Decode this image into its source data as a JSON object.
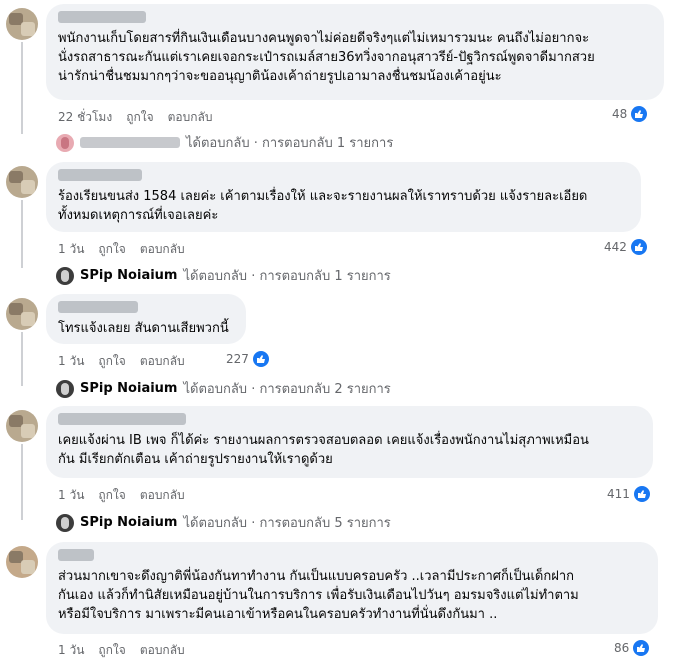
{
  "comments": [
    {
      "text_lines": [
        "พนักงานเก็บโดยสารที่กินเงินเดือนบางคนพูดจาไม่ค่อยดีจริงๆแต่ไม่เหมารวมนะ คนถึงไม่อยากจะ",
        "นั่งรถสาธารณะกันแต่เราเคยเจอกระเป๋ารถเมล์สาย36ทวิ่งจากอนุสาวรีย์-ปัฐวิกรณ์พูดจาดีมากสวย",
        "น่ารักน่าชื่นชมมากๆว่าจะขออนุญาติน้องเค้าถ่ายรูปเอามาลงชื่นชมน้องเค้าอยู่นะ"
      ],
      "time": "22 ชั่วโมง",
      "like_label": "ถูกใจ",
      "reply_label": "ตอบกลับ",
      "reactions": "48",
      "reply_summary": "ได้ตอบกลับ · การตอบกลับ 1 รายการ",
      "reply_user": ""
    },
    {
      "text_lines": [
        "ร้องเรียนขนส่ง 1584 เลยค่ะ เค้าตามเรื่องให้ และจะรายงานผลให้เราทราบด้วย แจ้งรายละเอียด",
        "ทั้งหมดเหตุการณ์ที่เจอเลยค่ะ"
      ],
      "time": "1 วัน",
      "like_label": "ถูกใจ",
      "reply_label": "ตอบกลับ",
      "reactions": "442",
      "reply_summary": "ได้ตอบกลับ · การตอบกลับ 1 รายการ",
      "reply_user": "SPip Noiaium"
    },
    {
      "text_lines": [
        "โทรแจ้งเลยย สันดานเสียพวกนี้"
      ],
      "time": "1 วัน",
      "like_label": "ถูกใจ",
      "reply_label": "ตอบกลับ",
      "reactions": "227",
      "reply_summary": "ได้ตอบกลับ · การตอบกลับ 2 รายการ",
      "reply_user": "SPip Noiaium"
    },
    {
      "text_lines": [
        "เคยแจ้งผ่าน IB เพจ ก็ได้ค่ะ รายงานผลการตรวจสอบตลอด เคยแจ้งเรื่องพนักงานไม่สุภาพเหมือน",
        "กัน มีเรียกตักเตือน เค้าถ่ายรูปรายงานให้เราดูด้วย"
      ],
      "time": "1 วัน",
      "like_label": "ถูกใจ",
      "reply_label": "ตอบกลับ",
      "reactions": "411",
      "reply_summary": "ได้ตอบกลับ · การตอบกลับ 5 รายการ",
      "reply_user": "SPip Noiaium"
    },
    {
      "text_lines": [
        "ส่วนมากเขาจะดึงญาติพี่น้องกันทาทำงาน กันเป็นแบบครอบครัว ..เวลามีประกาศก็เป็นเด็กฝาก",
        "กันเอง แล้วก็ทำนิสัยเหมือนอยู่บ้านในการบริการ เพื่อรับเงินเดือนไปวันๆ อมรมจริงแต่ไม่ทำตาม",
        "หรือมีใจบริการ มาเพราะมีคนเอาเข้าหรือคนในครอบครัวทำงานที่นั่นดึงกันมา .."
      ],
      "time": "1 วัน",
      "like_label": "ถูกใจ",
      "reply_label": "ตอบกลับ",
      "reactions": "86",
      "reply_summary": "",
      "reply_user": ""
    }
  ],
  "icons": {
    "like": "thumbs-up-icon"
  },
  "colors": {
    "bubble": "#f0f2f5",
    "like_blue": "#1877f2",
    "secondary_text": "#65676b"
  }
}
